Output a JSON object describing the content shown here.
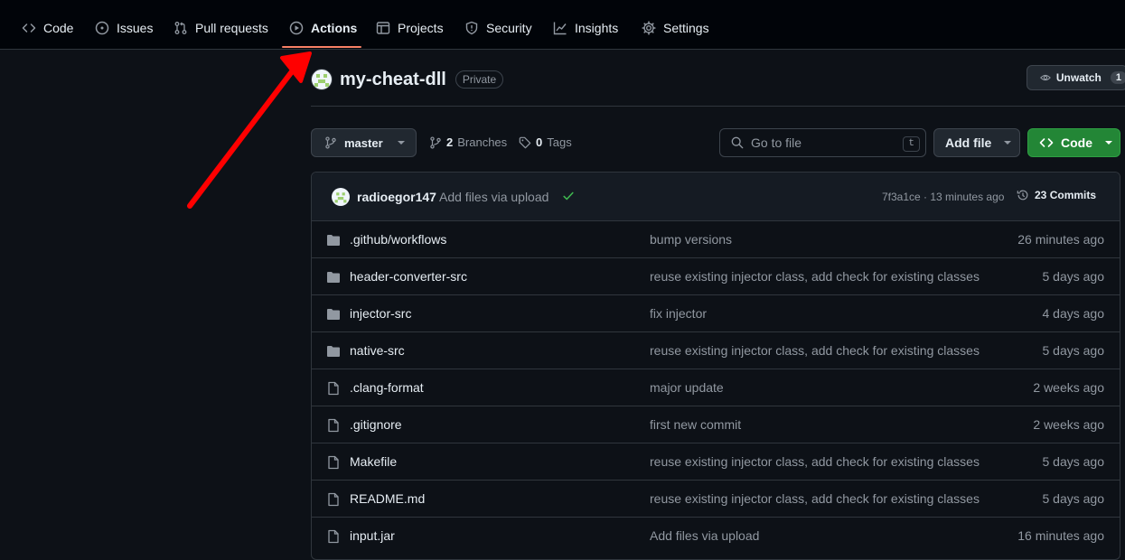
{
  "nav": {
    "tabs": [
      {
        "label": "Code",
        "icon": "code-icon"
      },
      {
        "label": "Issues",
        "icon": "issue-icon"
      },
      {
        "label": "Pull requests",
        "icon": "pull-request-icon"
      },
      {
        "label": "Actions",
        "icon": "play-icon",
        "active": true
      },
      {
        "label": "Projects",
        "icon": "table-icon"
      },
      {
        "label": "Security",
        "icon": "shield-icon"
      },
      {
        "label": "Insights",
        "icon": "graph-icon"
      },
      {
        "label": "Settings",
        "icon": "gear-icon"
      }
    ]
  },
  "repo": {
    "name": "my-cheat-dll",
    "visibility": "Private",
    "unwatch_label": "Unwatch",
    "watch_count": "1"
  },
  "toolbar": {
    "branch": "master",
    "branches_count": "2",
    "branches_label": "Branches",
    "tags_count": "0",
    "tags_label": "Tags",
    "search_placeholder": "Go to file",
    "search_shortcut": "t",
    "add_file_label": "Add file",
    "code_label": "Code"
  },
  "latest_commit": {
    "author": "radioegor147",
    "message": "Add files via upload",
    "sha": "7f3a1ce",
    "time": "13 minutes ago",
    "commits_count": "23",
    "commits_label": "Commits"
  },
  "files": [
    {
      "type": "dir",
      "name": ".github/workflows",
      "message": "bump versions",
      "time": "26 minutes ago"
    },
    {
      "type": "dir",
      "name": "header-converter-src",
      "message": "reuse existing injector class, add check for existing classes",
      "time": "5 days ago"
    },
    {
      "type": "dir",
      "name": "injector-src",
      "message": "fix injector",
      "time": "4 days ago"
    },
    {
      "type": "dir",
      "name": "native-src",
      "message": "reuse existing injector class, add check for existing classes",
      "time": "5 days ago"
    },
    {
      "type": "file",
      "name": ".clang-format",
      "message": "major update",
      "time": "2 weeks ago"
    },
    {
      "type": "file",
      "name": ".gitignore",
      "message": "first new commit",
      "time": "2 weeks ago"
    },
    {
      "type": "file",
      "name": "Makefile",
      "message": "reuse existing injector class, add check for existing classes",
      "time": "5 days ago"
    },
    {
      "type": "file",
      "name": "README.md",
      "message": "reuse existing injector class, add check for existing classes",
      "time": "5 days ago"
    },
    {
      "type": "file",
      "name": "input.jar",
      "message": "Add files via upload",
      "time": "16 minutes ago"
    }
  ],
  "annotation": {
    "color": "#ff0000",
    "points_to": "Actions"
  },
  "colors": {
    "accent_green": "#238636",
    "active_underline": "#f78166"
  }
}
